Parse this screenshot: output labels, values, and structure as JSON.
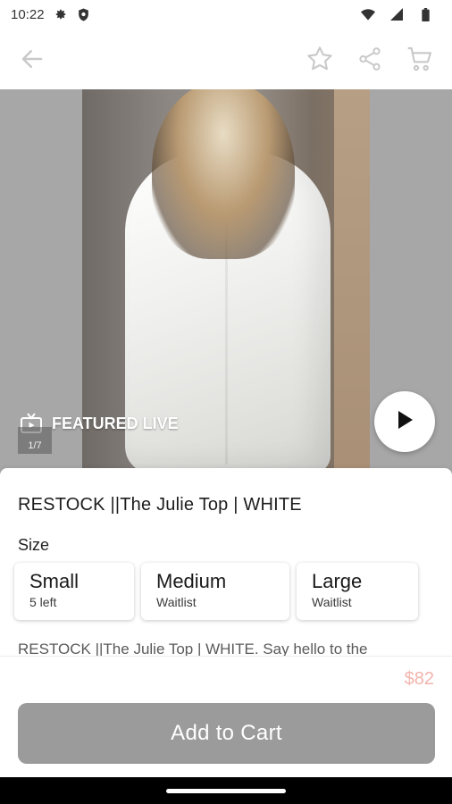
{
  "status_bar": {
    "time": "10:22",
    "icons": [
      "gear-icon",
      "shield-icon",
      "wifi-icon",
      "cell-signal-icon",
      "battery-icon"
    ]
  },
  "app_bar": {
    "icons": [
      "back-arrow-icon",
      "star-icon",
      "share-icon",
      "cart-icon"
    ]
  },
  "hero": {
    "badge_label": "FEATURED LIVE",
    "page_counter": "1/7",
    "icons": [
      "tv-icon",
      "play-icon"
    ]
  },
  "product": {
    "title": "RESTOCK ||The Julie Top | WHITE",
    "size_label": "Size",
    "sizes": [
      {
        "name": "Small",
        "stock": "5 left"
      },
      {
        "name": "Medium",
        "stock": "Waitlist"
      },
      {
        "name": "Large",
        "stock": "Waitlist"
      }
    ],
    "description": "RESTOCK ||The Julie Top | WHITE. Say hello to the"
  },
  "footer": {
    "price": "$82",
    "add_to_cart_label": "Add to Cart"
  },
  "colors": {
    "price": "#f2b4ad",
    "button_disabled": "#9b9b9b"
  }
}
